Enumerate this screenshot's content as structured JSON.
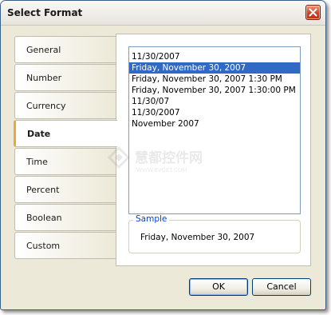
{
  "dialog": {
    "title": "Select Format",
    "close_icon": "close-icon"
  },
  "tabs": [
    {
      "label": "General"
    },
    {
      "label": "Number"
    },
    {
      "label": "Currency"
    },
    {
      "label": "Date",
      "active": true
    },
    {
      "label": "Time"
    },
    {
      "label": "Percent"
    },
    {
      "label": "Boolean"
    },
    {
      "label": "Custom"
    }
  ],
  "format_list": {
    "items": [
      "11/30/2007",
      "Friday, November 30, 2007",
      "Friday, November 30, 2007 1:30 PM",
      "Friday, November 30, 2007 1:30:00 PM",
      "11/30/07",
      "11/30/2007",
      "November 2007"
    ],
    "selected_index": 1
  },
  "sample": {
    "legend": "Sample",
    "value": "Friday, November 30, 2007"
  },
  "buttons": {
    "ok_label": "OK",
    "cancel_label": "Cancel"
  },
  "watermark": {
    "text": "慧都控件网",
    "subtext": "WWW.EVGET.COM"
  },
  "colors": {
    "selection": "#316ac5",
    "active_tab_accent": "#f3a33a",
    "close_button": "#d2421f",
    "legend_text": "#0046d5"
  }
}
